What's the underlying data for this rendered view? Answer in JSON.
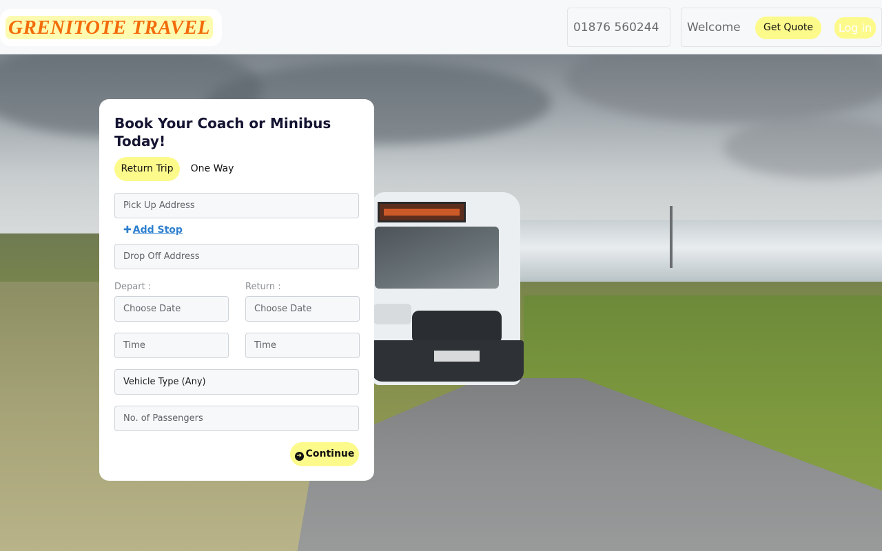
{
  "header": {
    "logo_text": "GRENITOTE TRAVEL",
    "phone": "01876 560244",
    "welcome": "Welcome",
    "get_quote_label": "Get Quote",
    "login_label": "Log in"
  },
  "colors": {
    "accent_yellow": "#fdfa8c",
    "logo_orange": "#f36b0a",
    "title_navy": "#141432",
    "link_blue": "#2d7fd0"
  },
  "booking": {
    "title": "Book Your Coach or Minibus Today!",
    "trip_types": [
      "Return Trip",
      "One Way"
    ],
    "selected_trip": "Return Trip",
    "pickup_placeholder": "Pick Up Address",
    "add_stop_label": "Add Stop",
    "add_stop_icon": "plus-icon",
    "dropoff_placeholder": "Drop Off Address",
    "depart_label": "Depart :",
    "return_label": "Return :",
    "depart_date_placeholder": "Choose Date",
    "return_date_placeholder": "Choose Date",
    "depart_time_placeholder": "Time",
    "return_time_placeholder": "Time",
    "vehicle_type_value": "Vehicle Type (Any)",
    "passengers_placeholder": "No. of Passengers",
    "continue_label": "Continue",
    "continue_icon": "arrow-circle-right-icon"
  }
}
